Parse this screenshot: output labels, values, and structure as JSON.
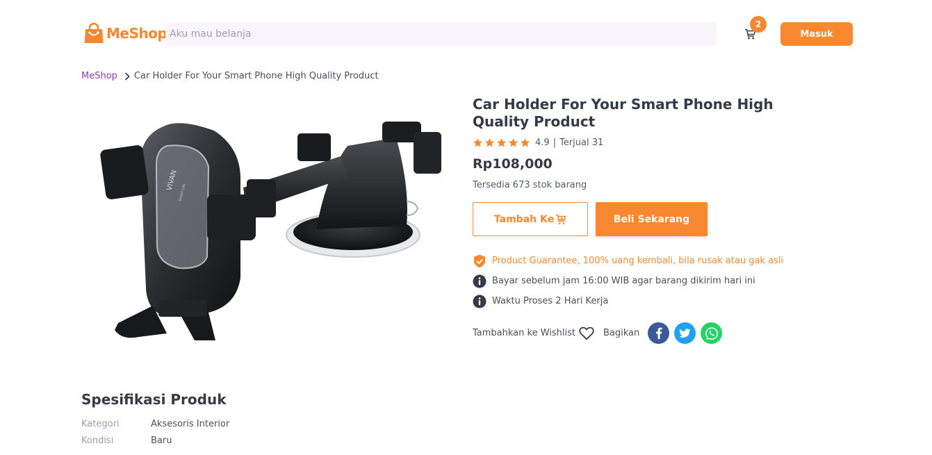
{
  "header": {
    "logo_text": "MeShop",
    "search_placeholder": "Aku mau belanja",
    "cart_count": "2",
    "login_label": "Masuk",
    "brand_color": "#f7882f"
  },
  "breadcrumb": {
    "home": "MeShop",
    "current": "Car Holder For Your Smart Phone High Quality Product"
  },
  "product": {
    "title": "Car Holder For Your Smart Phone High Quality Product",
    "rating": "4.9",
    "stars": 5,
    "sold": "Terjual 31",
    "price": "Rp108,000",
    "stock": "Tersedia 673 stok barang",
    "add_to_cart_label": "Tambah Ke",
    "buy_now_label": "Beli Sekarang",
    "image_brand_text": "VIVAN",
    "image_brand_subtext": "Smart Life",
    "notes": {
      "guarantee": "Product Guarantee, 100% uang kembali, bila rusak atau gak asli",
      "cutoff": "Bayar sebelum jam 16:00 WIB agar barang dikirim hari ini",
      "process": "Waktu Proses 2 Hari Kerja"
    },
    "wishlist_label": "Tambahkan ke Wishlist",
    "share_label": "Bagikan",
    "share_icons": [
      "facebook-icon",
      "twitter-icon",
      "whatsapp-icon"
    ]
  },
  "specs": {
    "title": "Spesifikasi Produk",
    "rows": [
      {
        "key": "Kategori",
        "value": "Aksesoris Interior"
      },
      {
        "key": "Kondisi",
        "value": "Baru"
      }
    ]
  }
}
